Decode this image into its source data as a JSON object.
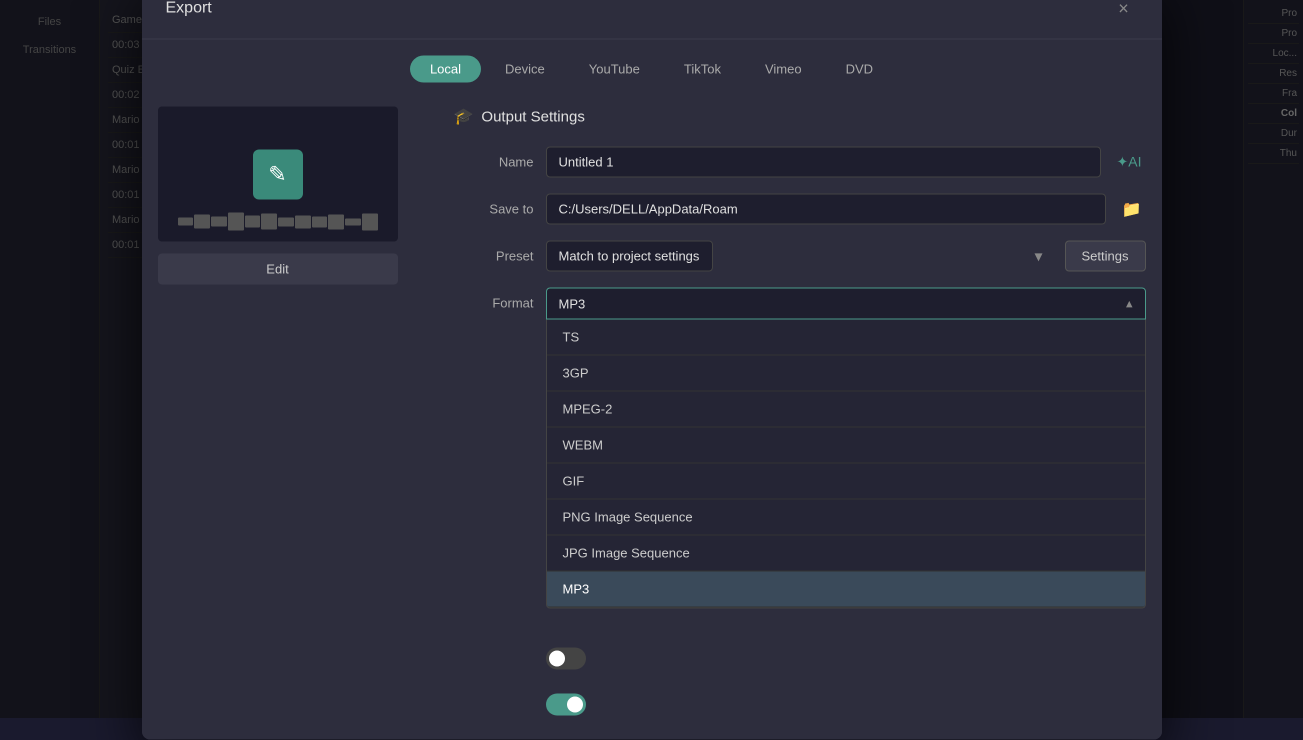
{
  "app": {
    "title": "Export",
    "pro_label": "Pro"
  },
  "dialog": {
    "title": "Export",
    "close_label": "×",
    "tabs": [
      {
        "id": "local",
        "label": "Local",
        "active": true
      },
      {
        "id": "device",
        "label": "Device",
        "active": false
      },
      {
        "id": "youtube",
        "label": "YouTube",
        "active": false
      },
      {
        "id": "tiktok",
        "label": "TikTok",
        "active": false
      },
      {
        "id": "vimeo",
        "label": "Vimeo",
        "active": false
      },
      {
        "id": "dvd",
        "label": "DVD",
        "active": false
      }
    ],
    "preview": {
      "edit_label": "Edit"
    },
    "settings": {
      "header": "Output Settings",
      "name_label": "Name",
      "name_value": "Untitled 1",
      "save_to_label": "Save to",
      "save_to_value": "C:/Users/DELL/AppData/Roam",
      "preset_label": "Preset",
      "preset_value": "Match to project settings",
      "format_label": "Format",
      "format_value": "MP3",
      "settings_btn": "Settings"
    },
    "format_options": [
      {
        "id": "ts",
        "label": "TS"
      },
      {
        "id": "3gp",
        "label": "3GP"
      },
      {
        "id": "mpeg2",
        "label": "MPEG-2"
      },
      {
        "id": "webm",
        "label": "WEBM"
      },
      {
        "id": "gif",
        "label": "GIF"
      },
      {
        "id": "png-seq",
        "label": "PNG Image Sequence"
      },
      {
        "id": "jpg-seq",
        "label": "JPG Image Sequence"
      },
      {
        "id": "mp3",
        "label": "MP3",
        "selected": true
      }
    ],
    "toggles": [
      {
        "id": "toggle1",
        "state": "off"
      },
      {
        "id": "toggle2",
        "state": "on"
      }
    ]
  },
  "sidebar": {
    "items": [
      {
        "label": "Files"
      },
      {
        "label": "Transitions"
      }
    ]
  },
  "left_panel": {
    "items": [
      {
        "label": "Game Clear G..."
      },
      {
        "label": "00:03"
      },
      {
        "label": "Quiz Ending-..."
      },
      {
        "label": "00:02"
      },
      {
        "label": "Mario Game"
      },
      {
        "label": "00:01"
      },
      {
        "label": "Mario Pause"
      },
      {
        "label": "00:01"
      },
      {
        "label": "Mario Break..."
      },
      {
        "label": "00:01"
      }
    ]
  },
  "right_panel": {
    "items": [
      {
        "label": "Pro"
      },
      {
        "label": "Pro"
      },
      {
        "label": "Loc..."
      },
      {
        "label": "Res"
      },
      {
        "label": "Fra"
      },
      {
        "label": "Col"
      },
      {
        "label": "Dur"
      },
      {
        "label": "Thu"
      }
    ]
  }
}
